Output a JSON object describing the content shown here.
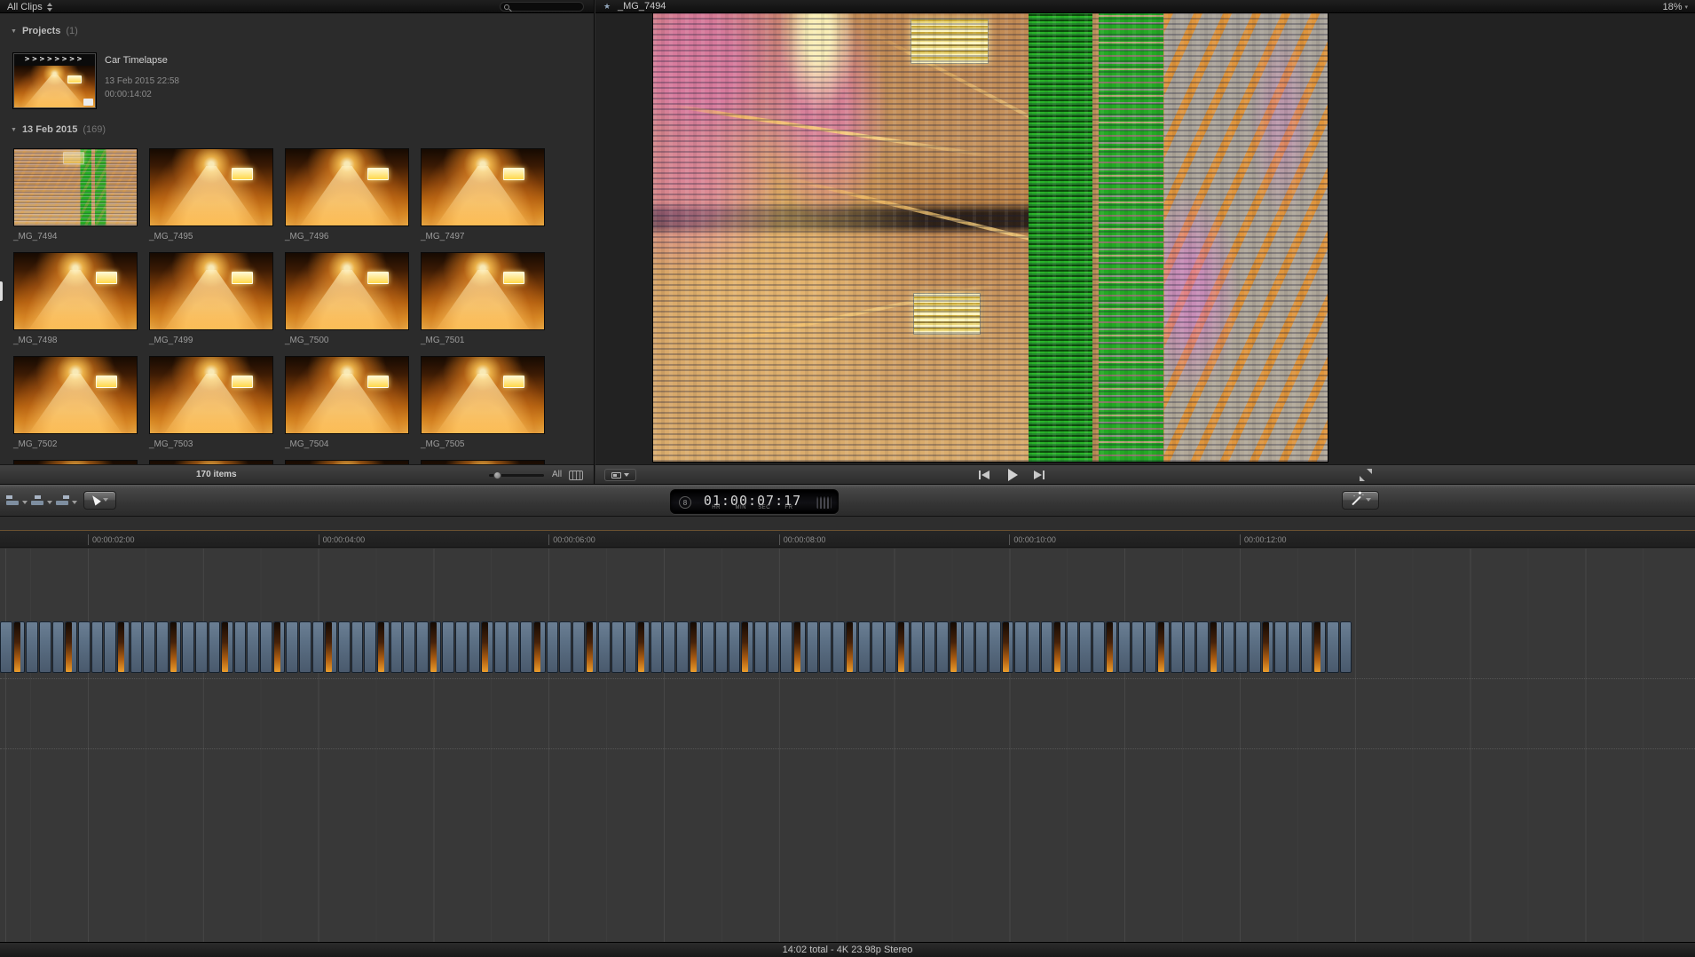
{
  "browser": {
    "filter_label": "All Clips",
    "search_placeholder": "",
    "projects_header": "Projects",
    "projects_count": "(1)",
    "project": {
      "name": "Car Timelapse",
      "date": "13 Feb 2015 22:58",
      "duration": "00:00:14:02"
    },
    "clips_header": "13 Feb 2015",
    "clips_count": "(169)",
    "clip_names": [
      "_MG_7494",
      "_MG_7495",
      "_MG_7496",
      "_MG_7497",
      "_MG_7498",
      "_MG_7499",
      "_MG_7500",
      "_MG_7501",
      "_MG_7502",
      "_MG_7503",
      "_MG_7504",
      "_MG_7505"
    ],
    "partial_next_row_thumbs": 4,
    "items_count": "170 items",
    "duration_filter_label": "All"
  },
  "viewer": {
    "title": "_MG_7494",
    "zoom_level": "18%"
  },
  "dashboard": {
    "badge": "8",
    "timecode": "01:00:07:17",
    "units": [
      "HR",
      "MIN",
      "SEC",
      "FR"
    ]
  },
  "timeline": {
    "ruler_labels": [
      "00:00:02:00",
      "00:00:04:00",
      "00:00:06:00",
      "00:00:08:00",
      "00:00:10:00",
      "00:00:12:00"
    ],
    "clip_count": 104,
    "status": "14:02 total - 4K 23.98p Stereo"
  },
  "icons": {
    "disclosure": "▼",
    "dropdown": "▾",
    "chevrons": ">>>>>>>>",
    "star": "★"
  },
  "colors": {
    "glitch_green": "#24a824",
    "clip_blue": "#5b6f84",
    "glow_orange": "#e8941a"
  }
}
